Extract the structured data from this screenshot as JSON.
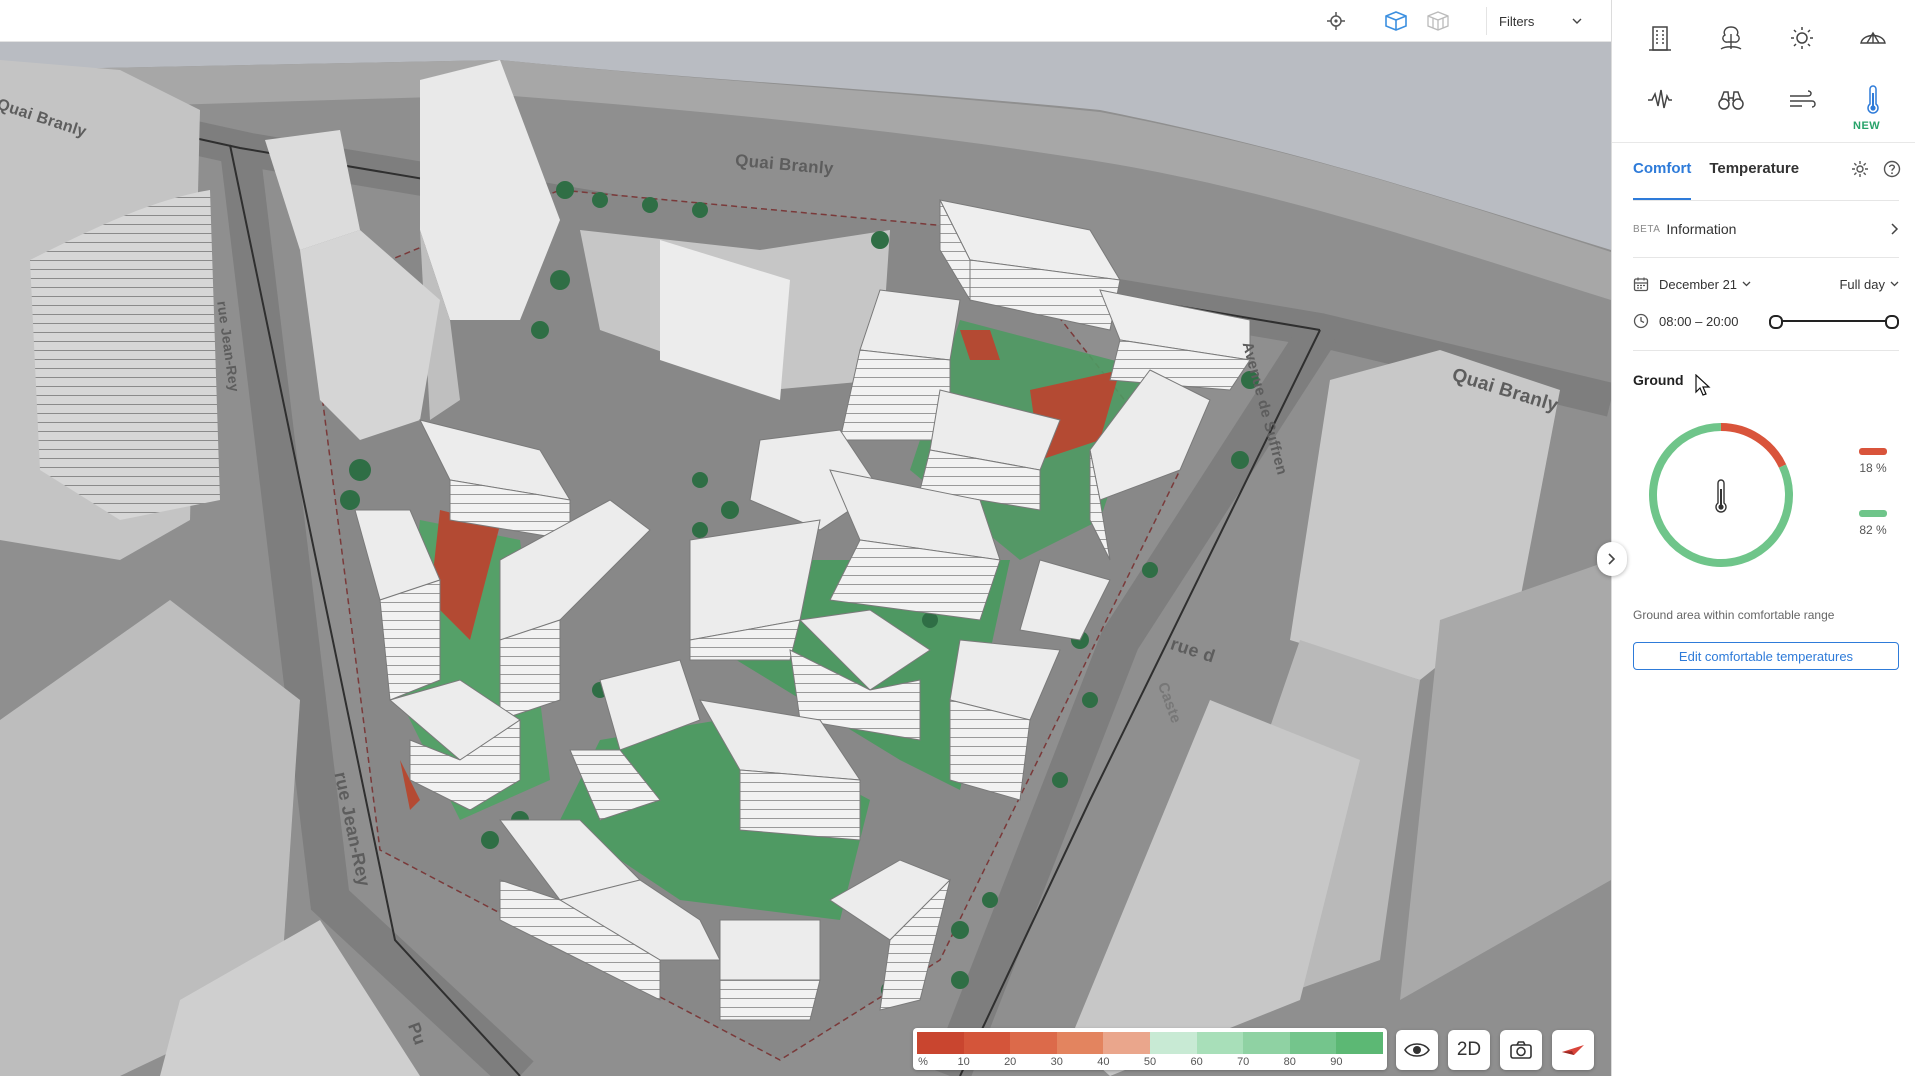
{
  "toolbar": {
    "filters_label": "Filters",
    "icons": [
      "locate-icon",
      "3d-box-icon",
      "3d-buildings-icon",
      "chevron-down-icon"
    ]
  },
  "map": {
    "street_labels": [
      "Quai Branly",
      "Quai Branly",
      "Quai Branly",
      "rue Jean-Rey",
      "rue Jean-Rey",
      "Avenue de Suffren",
      "rue d",
      "Caste",
      "Pu"
    ]
  },
  "legend": {
    "unit": "%",
    "ticks": [
      "10",
      "20",
      "30",
      "40",
      "50",
      "60",
      "70",
      "80",
      "90"
    ],
    "colors": [
      "#c9452f",
      "#d4553a",
      "#dc6a4a",
      "#e3845f",
      "#eaa68c",
      "#c8ead4",
      "#a8dfb9",
      "#8fd2a3",
      "#74c58c",
      "#5cb874"
    ]
  },
  "bottom_controls": {
    "mode_label": "2D",
    "icons": [
      "eye-icon",
      "camera-icon",
      "compass-icon"
    ]
  },
  "panel": {
    "icon_grid": [
      "building-icon",
      "tree-icon",
      "sun-icon",
      "umbrella-icon",
      "noise-icon",
      "binoculars-icon",
      "wind-icon",
      "thermometer-icon"
    ],
    "new_badge": "NEW",
    "tabs": [
      {
        "label": "Comfort",
        "active": true
      },
      {
        "label": "Temperature",
        "active": false
      }
    ],
    "info": {
      "badge": "BETA",
      "label": "Information"
    },
    "date": {
      "value": "December 21",
      "range": "Full day"
    },
    "time": {
      "value": "08:00 – 20:00",
      "slider_start": 0,
      "slider_end": 1
    },
    "ground": {
      "title": "Ground",
      "uncomfortable_pct": "18 %",
      "comfortable_pct": "82 %",
      "uncomfortable_fraction": 0.18,
      "comfortable_fraction": 0.82,
      "uncomfortable_color": "#d9543b",
      "comfortable_color": "#6fc58a",
      "caption": "Ground area within comfortable range",
      "edit_button": "Edit comfortable temperatures"
    }
  }
}
